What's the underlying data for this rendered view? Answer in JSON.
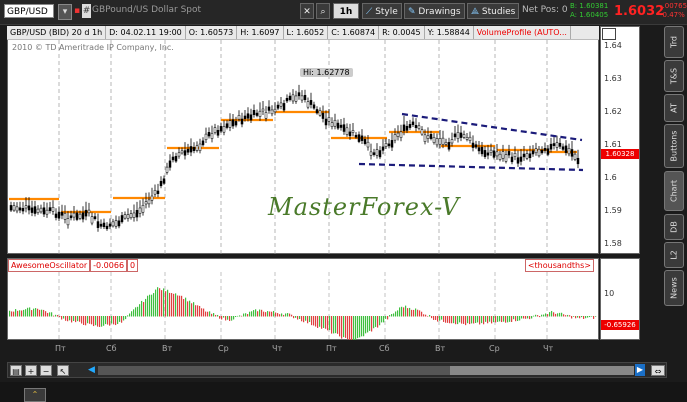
{
  "toolbar": {
    "symbol": "GBP/USD",
    "description": "GBPound/US Dollar Spot",
    "timeframe": "1h",
    "style_label": "Style",
    "drawings_label": "Drawings",
    "studies_label": "Studies",
    "net_pos": "Net Pos: 0",
    "bid": "B: 1.60381",
    "ask": "A: 1.60405",
    "last_price": "1.6032",
    "change_abs": "-.00765",
    "change_pct": "-0.47%"
  },
  "info": {
    "symbol": "GBP/USD (BID) 20 d 1h",
    "date": "D: 04.02.11 19:00",
    "open": "O: 1.60573",
    "high": "H: 1.6097",
    "low": "L: 1.6052",
    "close": "C: 1.60874",
    "range": "R: 0.0045",
    "y": "Y: 1.58844",
    "volume_profile": "VolumeProfile (AUTO..."
  },
  "copyright": "2010 © TD Ameritrade IP Company, Inc.",
  "hi_label": "Hi: 1.62778",
  "watermark": "MasterForex-V",
  "price_axis": {
    "ticks": [
      "1.64",
      "1.63",
      "1.62",
      "1.61",
      "1.6",
      "1.59",
      "1.58"
    ],
    "current_label": "1.60328"
  },
  "oscillator": {
    "name": "AwesomeOscillator",
    "value": "-0.0066",
    "zero": "0",
    "units": "<thousandths>",
    "axis_tick": "10",
    "current_label": "-0.65926"
  },
  "x_labels": [
    "Пт",
    "Сб",
    "Вт",
    "Ср",
    "Чт",
    "Пт",
    "Сб",
    "Вт",
    "Ср",
    "Чт"
  ],
  "side_tabs": [
    "Trd",
    "T&S",
    "AT",
    "Buttons",
    "Chart",
    "DB",
    "L2",
    "News"
  ],
  "colors": {
    "bg": "#1b1b1b",
    "price_red": "#ff2222",
    "bid_green": "#33cc33",
    "watermark": "#4a7a2a",
    "trend_line": "#1b1b7a",
    "volume_profile": "#ff8800"
  }
}
